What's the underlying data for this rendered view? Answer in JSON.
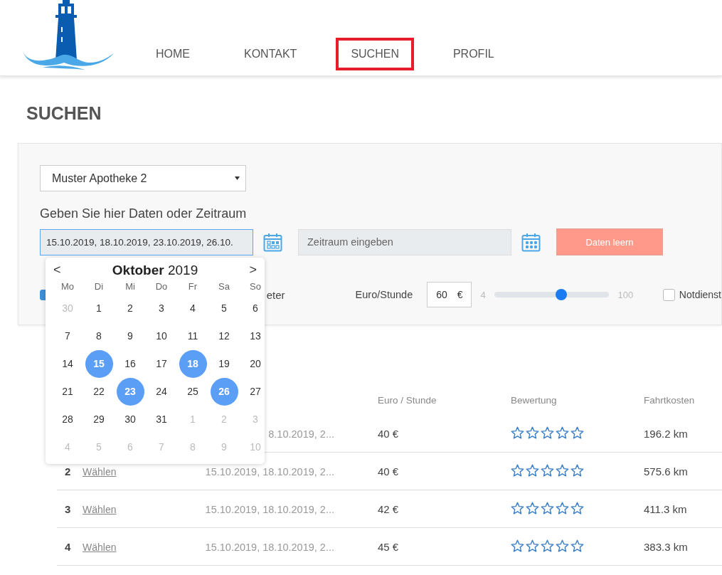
{
  "nav": [
    {
      "label": "HOME",
      "selected": false
    },
    {
      "label": "KONTAKT",
      "selected": false
    },
    {
      "label": "SUCHEN",
      "selected": true
    },
    {
      "label": "PROFIL",
      "selected": false
    }
  ],
  "page_title": "SUCHEN",
  "filter": {
    "pharmacy_select": {
      "value": "Muster Apotheke 2"
    },
    "dates_label": "Geben Sie hier Daten oder Zeitraum",
    "dates_field": {
      "value": "15.10.2019, 18.10.2019, 23.10.2019, 26.10."
    },
    "range_field": {
      "placeholder": "Zeitraum eingeben"
    },
    "clear_button": "Daten leern",
    "option_checkbox": {
      "label": "eter",
      "checked": true
    },
    "rate": {
      "label": "Euro/Stunde",
      "value": "60",
      "unit": "€",
      "min": "4",
      "max": "100",
      "level": 0.58
    },
    "emergency_checkbox": {
      "label": "Notdienst",
      "checked": false
    }
  },
  "calendar": {
    "prev": "<",
    "next": ">",
    "title": "**Oktober** 2019",
    "weekdays": [
      "Mo",
      "Di",
      "Mi",
      "Do",
      "Fr",
      "Sa",
      "So"
    ],
    "days": [
      {
        "label": "30",
        "muted": true,
        "selected": false
      },
      {
        "label": "1",
        "muted": false,
        "selected": false
      },
      {
        "label": "2",
        "muted": false,
        "selected": false
      },
      {
        "label": "3",
        "muted": false,
        "selected": false
      },
      {
        "label": "4",
        "muted": false,
        "selected": false
      },
      {
        "label": "5",
        "muted": false,
        "selected": false
      },
      {
        "label": "6",
        "muted": false,
        "selected": false
      },
      {
        "label": "7",
        "muted": false,
        "selected": false
      },
      {
        "label": "8",
        "muted": false,
        "selected": false
      },
      {
        "label": "9",
        "muted": false,
        "selected": false
      },
      {
        "label": "10",
        "muted": false,
        "selected": false
      },
      {
        "label": "11",
        "muted": false,
        "selected": false
      },
      {
        "label": "12",
        "muted": false,
        "selected": false
      },
      {
        "label": "13",
        "muted": false,
        "selected": false
      },
      {
        "label": "14",
        "muted": false,
        "selected": false
      },
      {
        "label": "15",
        "muted": false,
        "selected": true
      },
      {
        "label": "16",
        "muted": false,
        "selected": false
      },
      {
        "label": "17",
        "muted": false,
        "selected": false
      },
      {
        "label": "18",
        "muted": false,
        "selected": true
      },
      {
        "label": "19",
        "muted": false,
        "selected": false
      },
      {
        "label": "20",
        "muted": false,
        "selected": false
      },
      {
        "label": "21",
        "muted": false,
        "selected": false
      },
      {
        "label": "22",
        "muted": false,
        "selected": false
      },
      {
        "label": "23",
        "muted": false,
        "selected": true
      },
      {
        "label": "24",
        "muted": false,
        "selected": false
      },
      {
        "label": "25",
        "muted": false,
        "selected": false
      },
      {
        "label": "26",
        "muted": false,
        "selected": true
      },
      {
        "label": "27",
        "muted": false,
        "selected": false
      },
      {
        "label": "28",
        "muted": false,
        "selected": false
      },
      {
        "label": "29",
        "muted": false,
        "selected": false
      },
      {
        "label": "30",
        "muted": false,
        "selected": false
      },
      {
        "label": "31",
        "muted": false,
        "selected": false
      },
      {
        "label": "1",
        "muted": true,
        "selected": false
      },
      {
        "label": "2",
        "muted": true,
        "selected": false
      },
      {
        "label": "3",
        "muted": true,
        "selected": false
      },
      {
        "label": "4",
        "muted": true,
        "selected": false
      },
      {
        "label": "5",
        "muted": true,
        "selected": false
      },
      {
        "label": "6",
        "muted": true,
        "selected": false
      },
      {
        "label": "7",
        "muted": true,
        "selected": false
      },
      {
        "label": "8",
        "muted": true,
        "selected": false
      },
      {
        "label": "9",
        "muted": true,
        "selected": false
      },
      {
        "label": "10",
        "muted": true,
        "selected": false
      }
    ]
  },
  "table": {
    "columns": [
      "Euro / Stunde",
      "Bewertung",
      "Fahrtkosten"
    ],
    "rows": [
      {
        "dates": "8.10.2019, 2...",
        "rate": "40 €",
        "stars": 0,
        "distance": "196.2 km"
      },
      {
        "number": "2",
        "link": "Wählen",
        "dates": "15.10.2019, 18.10.2019, 2...",
        "rate": "40 €",
        "stars": 0,
        "distance": "575.6 km"
      },
      {
        "number": "3",
        "link": "Wählen",
        "dates": "15.10.2019, 18.10.2019, 2...",
        "rate": "42 €",
        "stars": 0,
        "distance": "411.3 km"
      },
      {
        "number": "4",
        "link": "Wählen",
        "dates": "15.10.2019, 18.10.2019, 2...",
        "rate": "45 €",
        "stars": 0,
        "distance": "383.3 km"
      }
    ]
  }
}
